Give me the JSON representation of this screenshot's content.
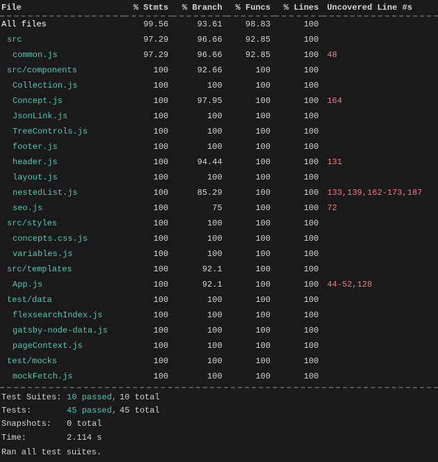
{
  "header": {
    "col_file": "File",
    "col_stmts": "% Stmts",
    "col_branch": "% Branch",
    "col_funcs": "% Funcs",
    "col_lines": "% Lines",
    "col_uncovered": "Uncovered Line #s"
  },
  "rows": [
    {
      "file": "All files",
      "stmts": "99.56",
      "branch": "93.61",
      "funcs": "98.83",
      "lines": "100",
      "uncovered": "",
      "indent": 0,
      "highlight": "all"
    },
    {
      "file": "src",
      "stmts": "97.29",
      "branch": "96.66",
      "funcs": "92.85",
      "lines": "100",
      "uncovered": "",
      "indent": 1,
      "highlight": "section"
    },
    {
      "file": "common.js",
      "stmts": "97.29",
      "branch": "96.66",
      "funcs": "92.85",
      "lines": "100",
      "uncovered": "48",
      "indent": 2,
      "highlight": "file"
    },
    {
      "file": "src/components",
      "stmts": "100",
      "branch": "92.66",
      "funcs": "100",
      "lines": "100",
      "uncovered": "",
      "indent": 1,
      "highlight": "section"
    },
    {
      "file": "Collection.js",
      "stmts": "100",
      "branch": "100",
      "funcs": "100",
      "lines": "100",
      "uncovered": "",
      "indent": 2,
      "highlight": "file"
    },
    {
      "file": "Concept.js",
      "stmts": "100",
      "branch": "97.95",
      "funcs": "100",
      "lines": "100",
      "uncovered": "164",
      "indent": 2,
      "highlight": "file"
    },
    {
      "file": "JsonLink.js",
      "stmts": "100",
      "branch": "100",
      "funcs": "100",
      "lines": "100",
      "uncovered": "",
      "indent": 2,
      "highlight": "file"
    },
    {
      "file": "TreeControls.js",
      "stmts": "100",
      "branch": "100",
      "funcs": "100",
      "lines": "100",
      "uncovered": "",
      "indent": 2,
      "highlight": "file"
    },
    {
      "file": "footer.js",
      "stmts": "100",
      "branch": "100",
      "funcs": "100",
      "lines": "100",
      "uncovered": "",
      "indent": 2,
      "highlight": "file"
    },
    {
      "file": "header.js",
      "stmts": "100",
      "branch": "94.44",
      "funcs": "100",
      "lines": "100",
      "uncovered": "131",
      "indent": 2,
      "highlight": "file"
    },
    {
      "file": "layout.js",
      "stmts": "100",
      "branch": "100",
      "funcs": "100",
      "lines": "100",
      "uncovered": "",
      "indent": 2,
      "highlight": "file"
    },
    {
      "file": "nestedList.js",
      "stmts": "100",
      "branch": "85.29",
      "funcs": "100",
      "lines": "100",
      "uncovered": "133,139,162-173,187",
      "indent": 2,
      "highlight": "file"
    },
    {
      "file": "seo.js",
      "stmts": "100",
      "branch": "75",
      "funcs": "100",
      "lines": "100",
      "uncovered": "72",
      "indent": 2,
      "highlight": "file"
    },
    {
      "file": "src/styles",
      "stmts": "100",
      "branch": "100",
      "funcs": "100",
      "lines": "100",
      "uncovered": "",
      "indent": 1,
      "highlight": "section"
    },
    {
      "file": "concepts.css.js",
      "stmts": "100",
      "branch": "100",
      "funcs": "100",
      "lines": "100",
      "uncovered": "",
      "indent": 2,
      "highlight": "file"
    },
    {
      "file": "variables.js",
      "stmts": "100",
      "branch": "100",
      "funcs": "100",
      "lines": "100",
      "uncovered": "",
      "indent": 2,
      "highlight": "file"
    },
    {
      "file": "src/templates",
      "stmts": "100",
      "branch": "92.1",
      "funcs": "100",
      "lines": "100",
      "uncovered": "",
      "indent": 1,
      "highlight": "section"
    },
    {
      "file": "App.js",
      "stmts": "100",
      "branch": "92.1",
      "funcs": "100",
      "lines": "100",
      "uncovered": "44-52,128",
      "indent": 2,
      "highlight": "file"
    },
    {
      "file": "test/data",
      "stmts": "100",
      "branch": "100",
      "funcs": "100",
      "lines": "100",
      "uncovered": "",
      "indent": 1,
      "highlight": "section"
    },
    {
      "file": "flexsearchIndex.js",
      "stmts": "100",
      "branch": "100",
      "funcs": "100",
      "lines": "100",
      "uncovered": "",
      "indent": 2,
      "highlight": "file"
    },
    {
      "file": "gatsby-node-data.js",
      "stmts": "100",
      "branch": "100",
      "funcs": "100",
      "lines": "100",
      "uncovered": "",
      "indent": 2,
      "highlight": "file"
    },
    {
      "file": "pageContext.js",
      "stmts": "100",
      "branch": "100",
      "funcs": "100",
      "lines": "100",
      "uncovered": "",
      "indent": 2,
      "highlight": "file"
    },
    {
      "file": "test/mocks",
      "stmts": "100",
      "branch": "100",
      "funcs": "100",
      "lines": "100",
      "uncovered": "",
      "indent": 1,
      "highlight": "section"
    },
    {
      "file": "mockFetch.js",
      "stmts": "100",
      "branch": "100",
      "funcs": "100",
      "lines": "100",
      "uncovered": "",
      "indent": 2,
      "highlight": "file"
    }
  ],
  "footer": {
    "test_suites_label": "Test Suites:",
    "test_suites_passed": "10 passed,",
    "test_suites_total": "10 total",
    "tests_label": "Tests:",
    "tests_passed": "45 passed,",
    "tests_total": "45 total",
    "snapshots_label": "Snapshots:",
    "snapshots_value": "0 total",
    "time_label": "Time:",
    "time_value": "2.114 s",
    "ran_text": "Ran all test suites."
  }
}
